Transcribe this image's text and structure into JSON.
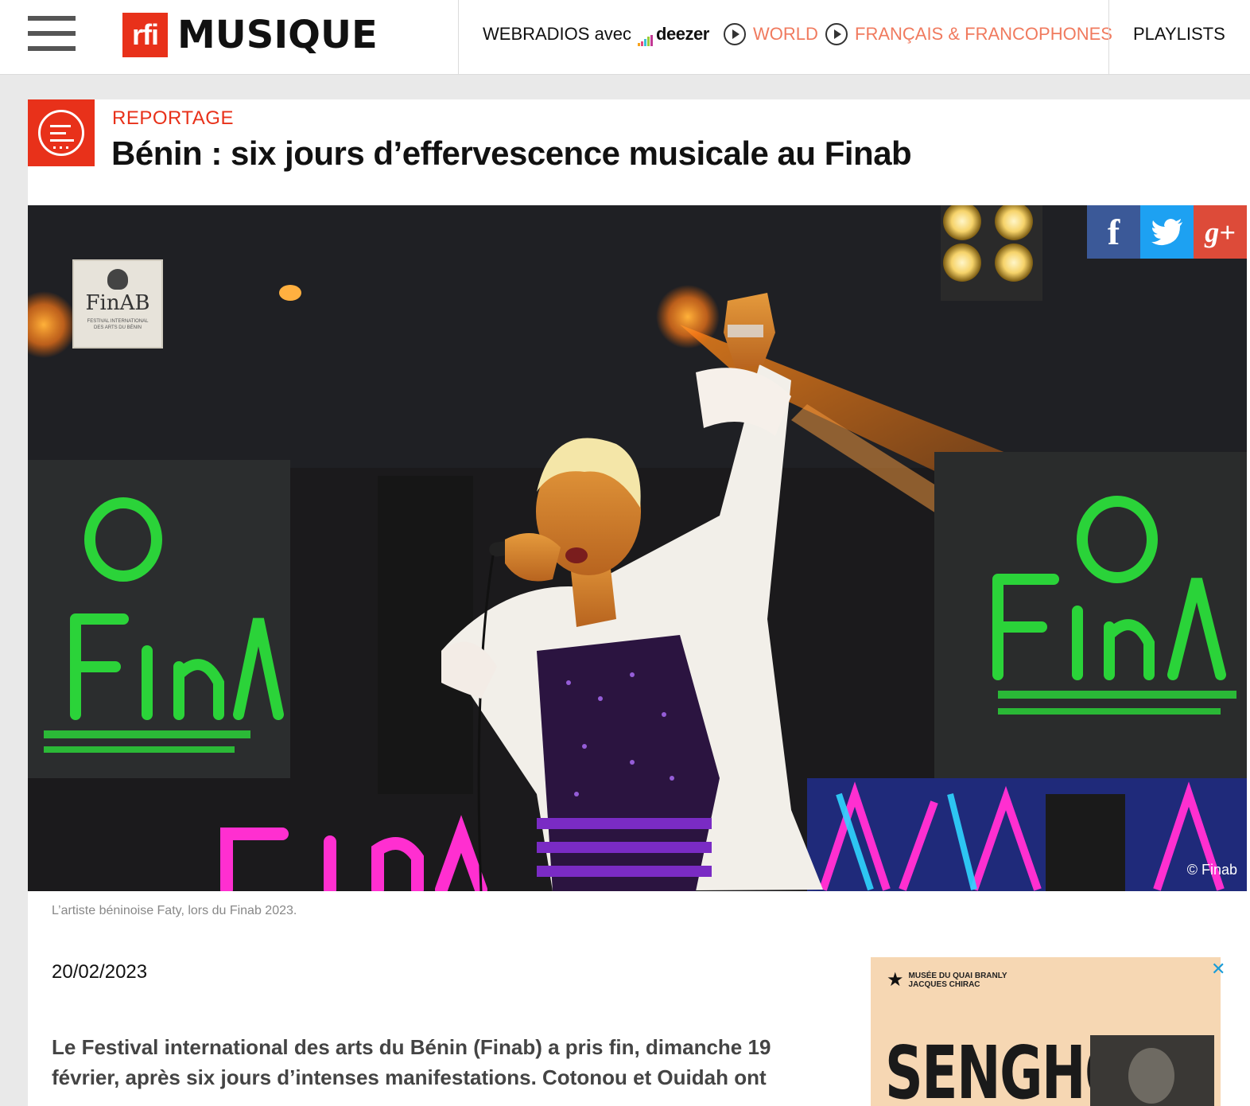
{
  "header": {
    "logo_mark": "rfi",
    "logo_word": "MUSIQUE",
    "nav": {
      "webradios_label": "WEBRADIOS avec",
      "deezer_label": "deezer",
      "world_label": "WORLD",
      "franco_label": "FRANÇAIS & FRANCOPHONES",
      "playlists_label": "PLAYLISTS"
    },
    "icons": [
      "hamburger-menu-icon",
      "play-icon"
    ]
  },
  "colors": {
    "brand_red": "#e8311a",
    "nav_accent": "#f07a5e",
    "facebook": "#3b5998",
    "twitter": "#1da1f2",
    "googleplus": "#dd4b39",
    "close_blue": "#1a9cd8"
  },
  "article": {
    "kicker": "REPORTAGE",
    "title": "Bénin : six jours d’effervescence musicale au Finab",
    "photo_credit": "© Finab",
    "photo_badge": {
      "brand": "FinAB",
      "subtitle": "FESTIVAL INTERNATIONAL DES ARTS DU BÉNIN"
    },
    "share": {
      "facebook": "f",
      "googleplus": "g+"
    },
    "caption": "L’artiste béninoise Faty, lors du Finab 2023.",
    "date": "20/02/2023",
    "lead": "Le Festival international des arts du Bénin (Finab) a pris fin, dimanche 19 février, après six jours d’intenses manifestations. Cotonou et Ouidah ont"
  },
  "ad": {
    "museum_line1": "MUSÉE DU QUAI BRANLY",
    "museum_line2": "JACQUES CHIRAC",
    "title": "SENGHOR",
    "close_label": "✕"
  }
}
